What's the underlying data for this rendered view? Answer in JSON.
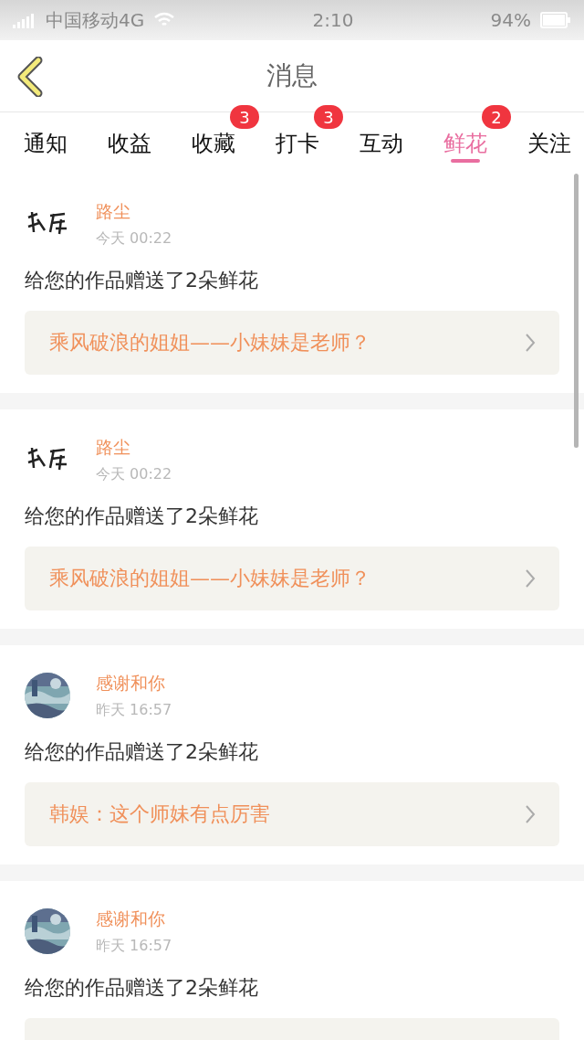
{
  "status_bar": {
    "carrier": "中国移动4G",
    "time": "2:10",
    "battery": "94%"
  },
  "header": {
    "title": "消息"
  },
  "tabs": [
    {
      "label": "通知",
      "selected": false
    },
    {
      "label": "收益",
      "selected": false
    },
    {
      "label": "收藏",
      "selected": false,
      "badge": "3"
    },
    {
      "label": "打卡",
      "selected": false,
      "badge": "3"
    },
    {
      "label": "互动",
      "selected": false
    },
    {
      "label": "鲜花",
      "selected": true,
      "badge": "2"
    },
    {
      "label": "关注",
      "selected": false
    }
  ],
  "messages": [
    {
      "name": "路尘",
      "time": "今天 00:22",
      "text": "给您的作品赠送了2朵鲜花",
      "link": "乘风破浪的姐姐——小妹妹是老师？"
    },
    {
      "name": "路尘",
      "time": "今天 00:22",
      "text": "给您的作品赠送了2朵鲜花",
      "link": "乘风破浪的姐姐——小妹妹是老师？"
    },
    {
      "name": "感谢和你",
      "time": "昨天 16:57",
      "text": "给您的作品赠送了2朵鲜花",
      "link": "韩娱：这个师妹有点厉害"
    },
    {
      "name": "感谢和你",
      "time": "昨天 16:57",
      "text": "给您的作品赠送了2朵鲜花"
    }
  ]
}
